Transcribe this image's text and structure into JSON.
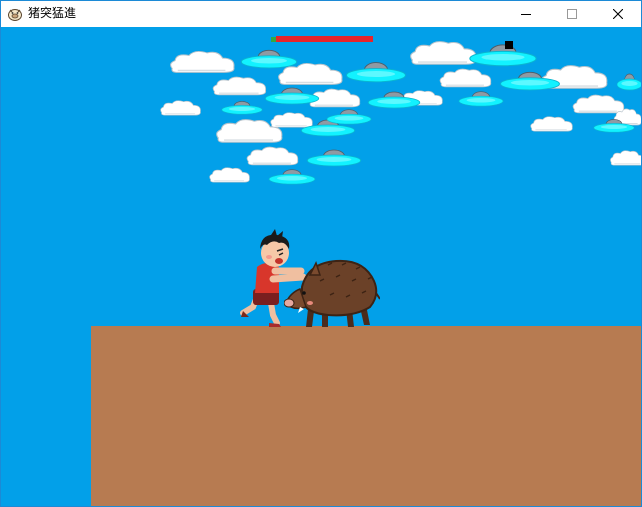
{
  "window": {
    "title": "猪突猛進",
    "icon": "boar-app-icon",
    "buttons": [
      "minimize-icon",
      "maximize-icon",
      "close-icon"
    ]
  },
  "game": {
    "sky_color": "#02a0e9",
    "ground_color": "#b77b51",
    "health": 0.95,
    "health_color": "#e8242b",
    "health_lost_color": "#31a944",
    "player": {
      "description_icon": "boy-pushing-boar"
    },
    "enemy": {
      "icon": "wild-boar"
    }
  }
}
